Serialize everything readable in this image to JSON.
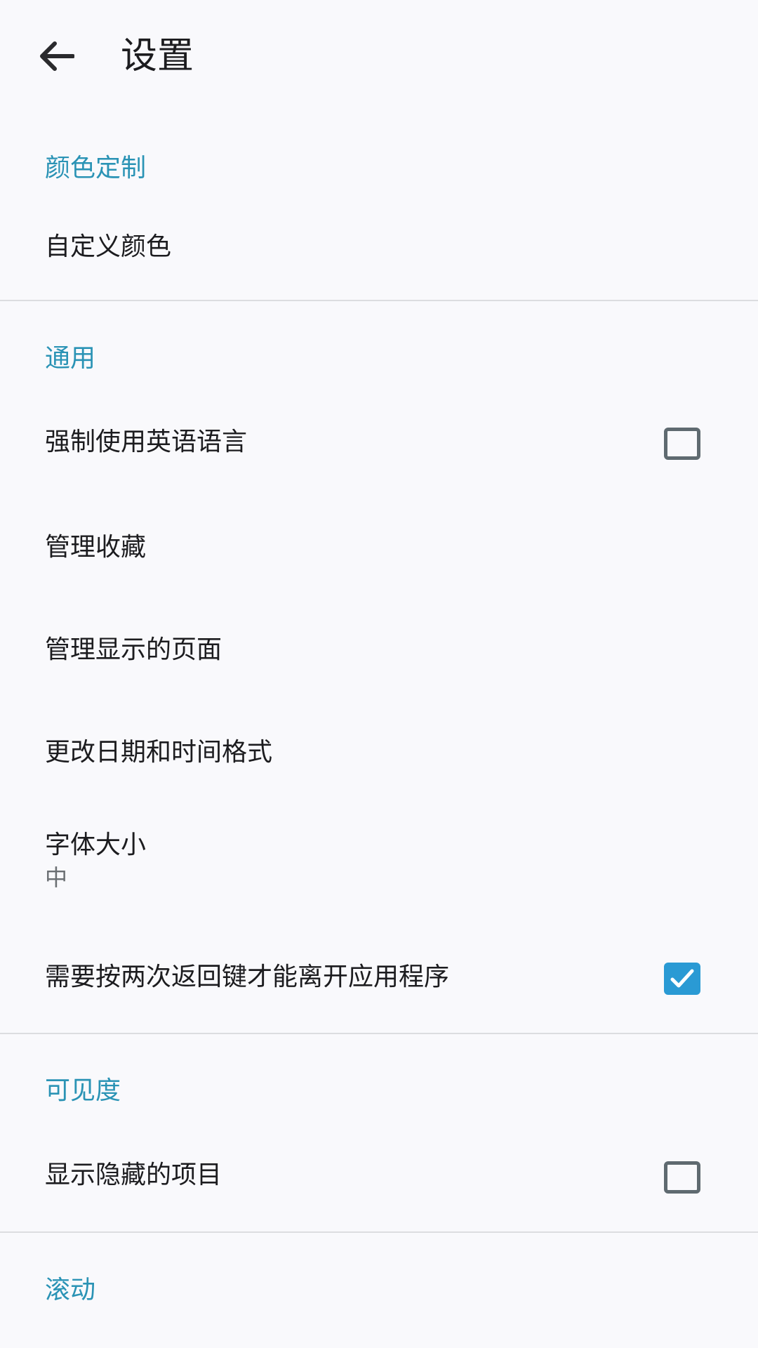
{
  "appbar": {
    "back_icon": "arrow-left-icon",
    "title": "设置"
  },
  "sections": {
    "color": {
      "header": "颜色定制",
      "custom_color": "自定义颜色"
    },
    "general": {
      "header": "通用",
      "force_english": {
        "label": "强制使用英语语言",
        "checked": false
      },
      "manage_favorites": "管理收藏",
      "manage_tabs": "管理显示的页面",
      "date_time_format": "更改日期和时间格式",
      "font_size": {
        "label": "字体大小",
        "value": "中"
      },
      "press_back_twice": {
        "label": "需要按两次返回键才能离开应用程序",
        "checked": true
      }
    },
    "visibility": {
      "header": "可见度",
      "show_hidden": {
        "label": "显示隐藏的项目",
        "checked": false
      }
    },
    "scrolling": {
      "header": "滚动"
    }
  },
  "colors": {
    "accent": "#2a93b5",
    "checkbox_checked": "#2a9ad4",
    "background": "#f9f9fc"
  }
}
